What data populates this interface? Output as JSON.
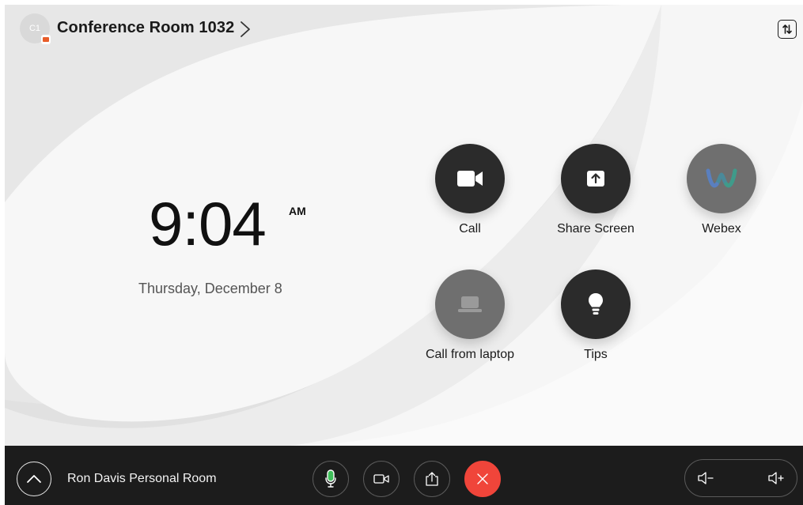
{
  "header": {
    "avatar_initials": "C1",
    "room_title": "Conference Room 1032"
  },
  "clock": {
    "time": "9:04",
    "meridiem": "AM",
    "date": "Thursday, December 8"
  },
  "actions": [
    {
      "label": "Call",
      "icon": "video-camera-icon"
    },
    {
      "label": "Share Screen",
      "icon": "share-screen-icon"
    },
    {
      "label": "Webex",
      "icon": "webex-logo-icon"
    },
    {
      "label": "Call from laptop",
      "icon": "laptop-icon"
    },
    {
      "label": "Tips",
      "icon": "lightbulb-icon"
    }
  ],
  "bottombar": {
    "personal_room": "Ron Davis Personal Room"
  },
  "colors": {
    "accent_end_call": "#f0453a",
    "mic_active": "#3fbf5a",
    "badge": "#e85d2a",
    "dark_button": "#2b2b2b",
    "grey_button": "#6f6f6f"
  }
}
